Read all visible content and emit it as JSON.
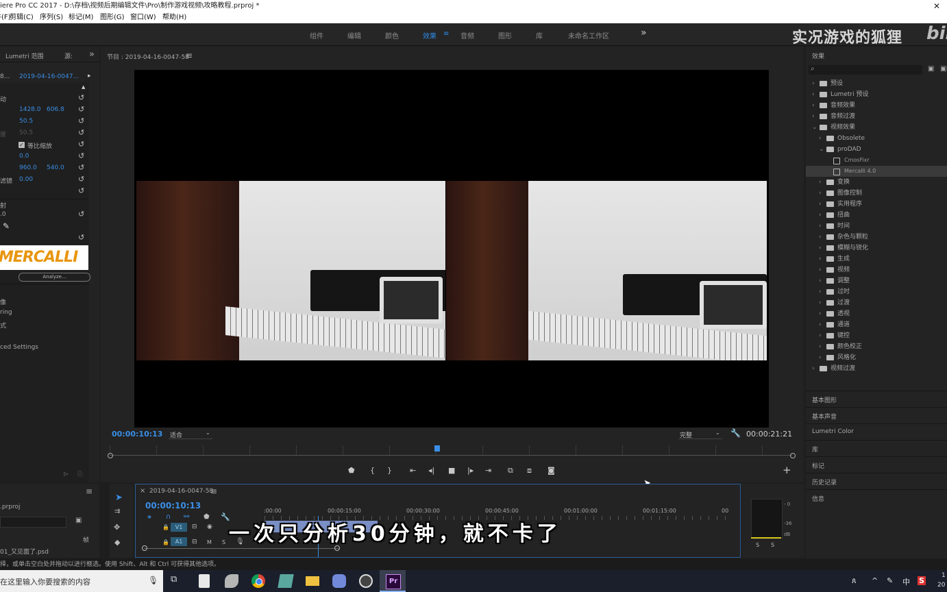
{
  "window": {
    "title": "iere Pro CC 2017 - D:\\存档\\视频后期编辑文件\\Pro\\制作游戏视频\\攻略教程.prproj *",
    "close_glyph": "✕"
  },
  "menu": [
    "件(F)",
    "剪辑(C)",
    "序列(S)",
    "标记(M)",
    "图形(G)",
    "窗口(W)",
    "帮助(H)"
  ],
  "workspaces": {
    "items": [
      "组件",
      "编辑",
      "颜色",
      "效果",
      "音频",
      "图形",
      "库",
      "未命名工作区"
    ],
    "active_index": 3,
    "menu_glyph": "≡",
    "more_glyph": "»"
  },
  "watermark": {
    "text": "实况游戏的狐狸",
    "logo": "bil"
  },
  "effect_controls": {
    "tabs": [
      "Lumetri 范围",
      "源:"
    ],
    "more_glyph": "»",
    "clip_left": "8...",
    "clip_name": "2019-04-16-0047...",
    "rows": [
      {
        "label": "动",
        "v1": "",
        "v2": ""
      },
      {
        "label": "",
        "v1": "1428.0",
        "v2": "606.8"
      },
      {
        "label": "",
        "v1": "50.5",
        "v2": ""
      },
      {
        "label": "度",
        "v1": "50.5",
        "v2": ""
      },
      {
        "label": "等比缩放",
        "v1": "",
        "v2": ""
      },
      {
        "label": "",
        "v1": "0.0",
        "v2": ""
      },
      {
        "label": "",
        "v1": "960.0",
        "v2": "540.0"
      },
      {
        "label": "滤镜",
        "v1": "0.00",
        "v2": ""
      }
    ],
    "row_label_prefix": "射",
    "row_zero": ".0",
    "reset_glyph": "↺",
    "mercalli_logo": "MERCALLI",
    "analyze_button": "Analyze...",
    "options": [
      "像",
      "ring",
      "式",
      "",
      "ced Settings"
    ]
  },
  "project_panel": {
    "file": ".prproj",
    "col_header": "帧",
    "item": "01_又见面了.psd"
  },
  "program_monitor": {
    "title": "节目 : 2019-04-16-0047-58",
    "menu_glyph": "≡",
    "timecode_current": "00:00:10:13",
    "fit": "适合",
    "quality": "完整",
    "timecode_duration": "00:00:21:21",
    "add_glyph": "+"
  },
  "timeline": {
    "sequence_name": "2019-04-16-0047-58",
    "close_glyph": "×",
    "timecode": "00:00:10:13",
    "ruler": [
      ":00:00",
      "00:00:15:00",
      "00:00:30:00",
      "00:00:45:00",
      "00:01:00:00",
      "00:01:15:00",
      "00"
    ],
    "tracks": [
      {
        "name": "V1"
      },
      {
        "name": "A1",
        "m": "M",
        "s": "S"
      }
    ],
    "clip_label": "ro"
  },
  "subtitle": "一次只分析30分钟，就不卡了",
  "audio_meter": {
    "ticks": [
      "- 0",
      "-36",
      "dB"
    ],
    "solo": [
      "S",
      "S"
    ]
  },
  "effects_panel": {
    "title": "效果",
    "search_glyph": "⌕",
    "tree": [
      {
        "label": "预设",
        "level": 0,
        "expanded": false
      },
      {
        "label": "Lumetri 预设",
        "level": 0,
        "expanded": false
      },
      {
        "label": "音频效果",
        "level": 0,
        "expanded": false
      },
      {
        "label": "音频过渡",
        "level": 0,
        "expanded": false
      },
      {
        "label": "视频效果",
        "level": 0,
        "expanded": true
      },
      {
        "label": "Obsolete",
        "level": 1,
        "expanded": false
      },
      {
        "label": "proDAD",
        "level": 1,
        "expanded": true
      },
      {
        "label": "CmosFixr",
        "level": 2,
        "expanded": false
      },
      {
        "label": "Mercalli 4.0",
        "level": 2,
        "expanded": false,
        "selected": true
      },
      {
        "label": "变换",
        "level": 1,
        "expanded": false
      },
      {
        "label": "图像控制",
        "level": 1,
        "expanded": false
      },
      {
        "label": "实用程序",
        "level": 1,
        "expanded": false
      },
      {
        "label": "扭曲",
        "level": 1,
        "expanded": false
      },
      {
        "label": "时间",
        "level": 1,
        "expanded": false
      },
      {
        "label": "杂色与颗粒",
        "level": 1,
        "expanded": false
      },
      {
        "label": "模糊与锐化",
        "level": 1,
        "expanded": false
      },
      {
        "label": "生成",
        "level": 1,
        "expanded": false
      },
      {
        "label": "视频",
        "level": 1,
        "expanded": false
      },
      {
        "label": "调整",
        "level": 1,
        "expanded": false
      },
      {
        "label": "过时",
        "level": 1,
        "expanded": false
      },
      {
        "label": "过渡",
        "level": 1,
        "expanded": false
      },
      {
        "label": "透视",
        "level": 1,
        "expanded": false
      },
      {
        "label": "通道",
        "level": 1,
        "expanded": false
      },
      {
        "label": "键控",
        "level": 1,
        "expanded": false
      },
      {
        "label": "颜色校正",
        "level": 1,
        "expanded": false
      },
      {
        "label": "风格化",
        "level": 1,
        "expanded": false
      },
      {
        "label": "视频过渡",
        "level": 0,
        "expanded": false
      }
    ],
    "sections": [
      "基本图形",
      "基本声音",
      "Lumetri Color",
      "库",
      "标记",
      "历史记录",
      "信息"
    ]
  },
  "status_bar": "择，或单击空白处并拖动以进行框选。使用 Shift、Alt 和 Ctrl 可获得其他选项。",
  "taskbar": {
    "search_placeholder": "在这里输入你要搜索的内容",
    "app_initials": "Pr",
    "tray": [
      "中",
      "S"
    ],
    "clock": [
      "1",
      "20"
    ]
  }
}
